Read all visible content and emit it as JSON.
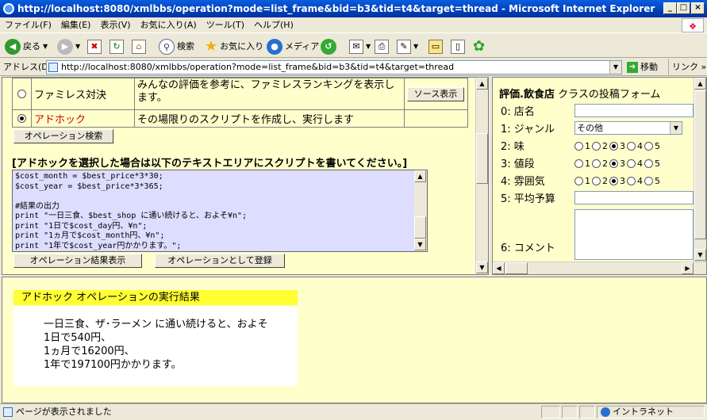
{
  "window": {
    "title": "http://localhost:8080/xmlbbs/operation?mode=list_frame&bid=b3&tid=t4&target=thread - Microsoft Internet Explorer",
    "min": "_",
    "max": "□",
    "close": "×"
  },
  "menu": [
    "ファイル(F)",
    "編集(E)",
    "表示(V)",
    "お気に入り(A)",
    "ツール(T)",
    "ヘルプ(H)"
  ],
  "toolbar": {
    "back": "戻る",
    "search": "検索",
    "favorites": "お気に入り",
    "media": "メディア"
  },
  "address": {
    "label": "アドレス(D)",
    "url": "http://localhost:8080/xmlbbs/operation?mode=list_frame&bid=b3&tid=t4&target=thread",
    "go": "移動",
    "links": "リンク »"
  },
  "left": {
    "ops": [
      {
        "name": "ファミレス対決",
        "desc": "みんなの評価を参考に、ファミレスランキングを表示します。",
        "button": "ソース表示",
        "selected": false
      },
      {
        "name": "アドホック",
        "desc": "その場限りのスクリプトを作成し、実行します",
        "button": "",
        "selected": true
      }
    ],
    "search_button": "オペレーション検索",
    "instruction": "[アドホックを選択した場合は以下のテキストエリアにスクリプトを書いてください。]",
    "script_lines": [
      "$cost_month = $best_price*3*30;",
      "$cost_year = $best_price*3*365;",
      "",
      "#結果の出力",
      "print \"一日三食、$best_shop に通い続けると、およそ¥n\";",
      "print \"1日で$cost_day円、¥n\";",
      "print \"1ヵ月で$cost_month円、¥n\";",
      "print \"1年で$cost_year円かかります。\";"
    ],
    "run_button": "オペレーション結果表示",
    "register_button": "オペレーションとして登録"
  },
  "right": {
    "title_bold": "評価.飲食店",
    "title_rest": " クラスの投稿フォーム",
    "fields": [
      {
        "label": "0:  店名",
        "type": "text"
      },
      {
        "label": "1:  ジャンル",
        "type": "select",
        "value": "その他"
      },
      {
        "label": "2:  味",
        "type": "radio",
        "selected": 3
      },
      {
        "label": "3:  値段",
        "type": "radio",
        "selected": 3
      },
      {
        "label": "4:  雰囲気",
        "type": "radio",
        "selected": 3
      },
      {
        "label": "5:  平均予算",
        "type": "text"
      },
      {
        "label": "6:  コメント",
        "type": "textarea"
      }
    ],
    "radio_options": [
      "1",
      "2",
      "3",
      "4",
      "5"
    ]
  },
  "result": {
    "header": "アドホック オペレーションの実行結果",
    "lines": [
      "一日三食、ザ･ラーメン に通い続けると、およそ",
      "1日で540円、",
      "1ヵ月で16200円、",
      "1年で197100円かかります。"
    ]
  },
  "status": {
    "text": "ページが表示されました",
    "zone": "イントラネット"
  }
}
